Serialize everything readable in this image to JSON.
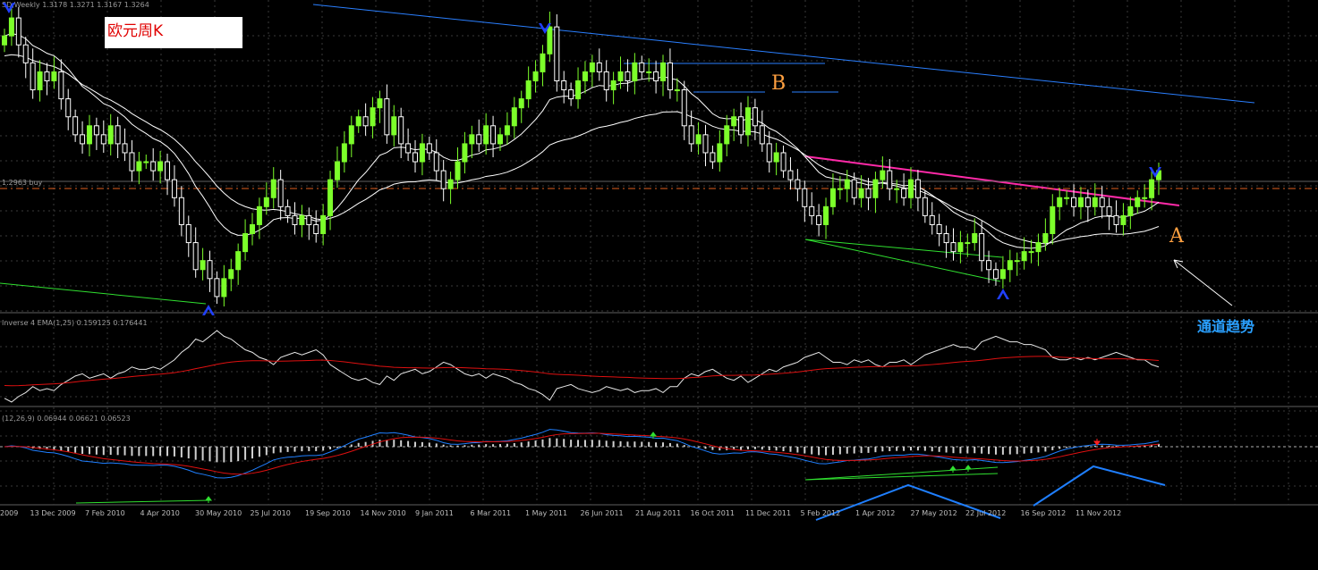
{
  "header": {
    "symbol_info": "SD,Weekly  1.3178 1.3271 1.3167 1.3264",
    "title": "欧元周K",
    "price_line_label": "1.2963 buy"
  },
  "panels": {
    "indicator1_info": "Inverse 4 EMA(1,25) 0.159125 0.176441",
    "indicator2_info": "(12,26,9) 0.06944 0.06621 0.06523"
  },
  "annotations": {
    "A": "A",
    "B": "B",
    "channel_trend": "通道趋势"
  },
  "colors": {
    "bull": "#7cff2a",
    "bear": "#ffffff",
    "ma": "#ffffff",
    "blue_line": "#2a7fff",
    "pink_line": "#ff2aa8",
    "green_line": "#30e030",
    "red_line": "#e01010",
    "macd_fast": "#1f7fff",
    "macd_slow": "#e01010",
    "hist": "#d0d0d0",
    "arrow": "#2040ff",
    "price_line": "#e06020"
  },
  "x_axis": {
    "dates": [
      "2009",
      "13 Dec 2009",
      "7 Feb 2010",
      "4 Apr 2010",
      "30 May 2010",
      "25 Jul 2010",
      "19 Sep 2010",
      "14 Nov 2010",
      "9 Jan 2011",
      "6 Mar 2011",
      "1 May 2011",
      "26 Jun 2011",
      "21 Aug 2011",
      "16 Oct 2011",
      "11 Dec 2011",
      "5 Feb 2012",
      "1 Apr 2012",
      "27 May 2012",
      "22 Jul 2012",
      "16 Sep 2012",
      "11 Nov 2012"
    ]
  },
  "chart_data": {
    "type": "candlestick",
    "title": "欧元周K",
    "candle_closes": [
      1.48,
      1.5,
      1.47,
      1.45,
      1.42,
      1.44,
      1.43,
      1.44,
      1.41,
      1.39,
      1.37,
      1.36,
      1.38,
      1.37,
      1.36,
      1.38,
      1.36,
      1.35,
      1.33,
      1.34,
      1.34,
      1.33,
      1.34,
      1.32,
      1.3,
      1.27,
      1.25,
      1.22,
      1.23,
      1.21,
      1.19,
      1.21,
      1.22,
      1.24,
      1.26,
      1.27,
      1.29,
      1.3,
      1.32,
      1.29,
      1.28,
      1.27,
      1.28,
      1.27,
      1.26,
      1.28,
      1.32,
      1.34,
      1.36,
      1.38,
      1.39,
      1.38,
      1.4,
      1.41,
      1.37,
      1.39,
      1.36,
      1.35,
      1.34,
      1.36,
      1.35,
      1.33,
      1.31,
      1.32,
      1.34,
      1.36,
      1.37,
      1.36,
      1.38,
      1.36,
      1.37,
      1.38,
      1.4,
      1.41,
      1.43,
      1.44,
      1.46,
      1.49,
      1.43,
      1.42,
      1.41,
      1.43,
      1.44,
      1.45,
      1.44,
      1.42,
      1.43,
      1.44,
      1.43,
      1.45,
      1.44,
      1.44,
      1.43,
      1.45,
      1.42,
      1.42,
      1.38,
      1.36,
      1.37,
      1.35,
      1.34,
      1.36,
      1.38,
      1.39,
      1.37,
      1.4,
      1.38,
      1.36,
      1.34,
      1.35,
      1.33,
      1.32,
      1.31,
      1.29,
      1.28,
      1.27,
      1.29,
      1.31,
      1.31,
      1.32,
      1.3,
      1.31,
      1.3,
      1.32,
      1.33,
      1.31,
      1.31,
      1.3,
      1.32,
      1.3,
      1.28,
      1.27,
      1.26,
      1.25,
      1.24,
      1.25,
      1.25,
      1.26,
      1.23,
      1.22,
      1.21,
      1.22,
      1.23,
      1.23,
      1.24,
      1.24,
      1.25,
      1.26,
      1.29,
      1.3,
      1.3,
      1.29,
      1.3,
      1.29,
      1.3,
      1.29,
      1.28,
      1.27,
      1.28,
      1.29,
      1.3,
      1.3,
      1.32,
      1.33
    ],
    "ma_fast_label": "",
    "ma_slow_label": "",
    "price_line_value": 1.2963,
    "ylim": [
      1.18,
      1.51
    ]
  }
}
